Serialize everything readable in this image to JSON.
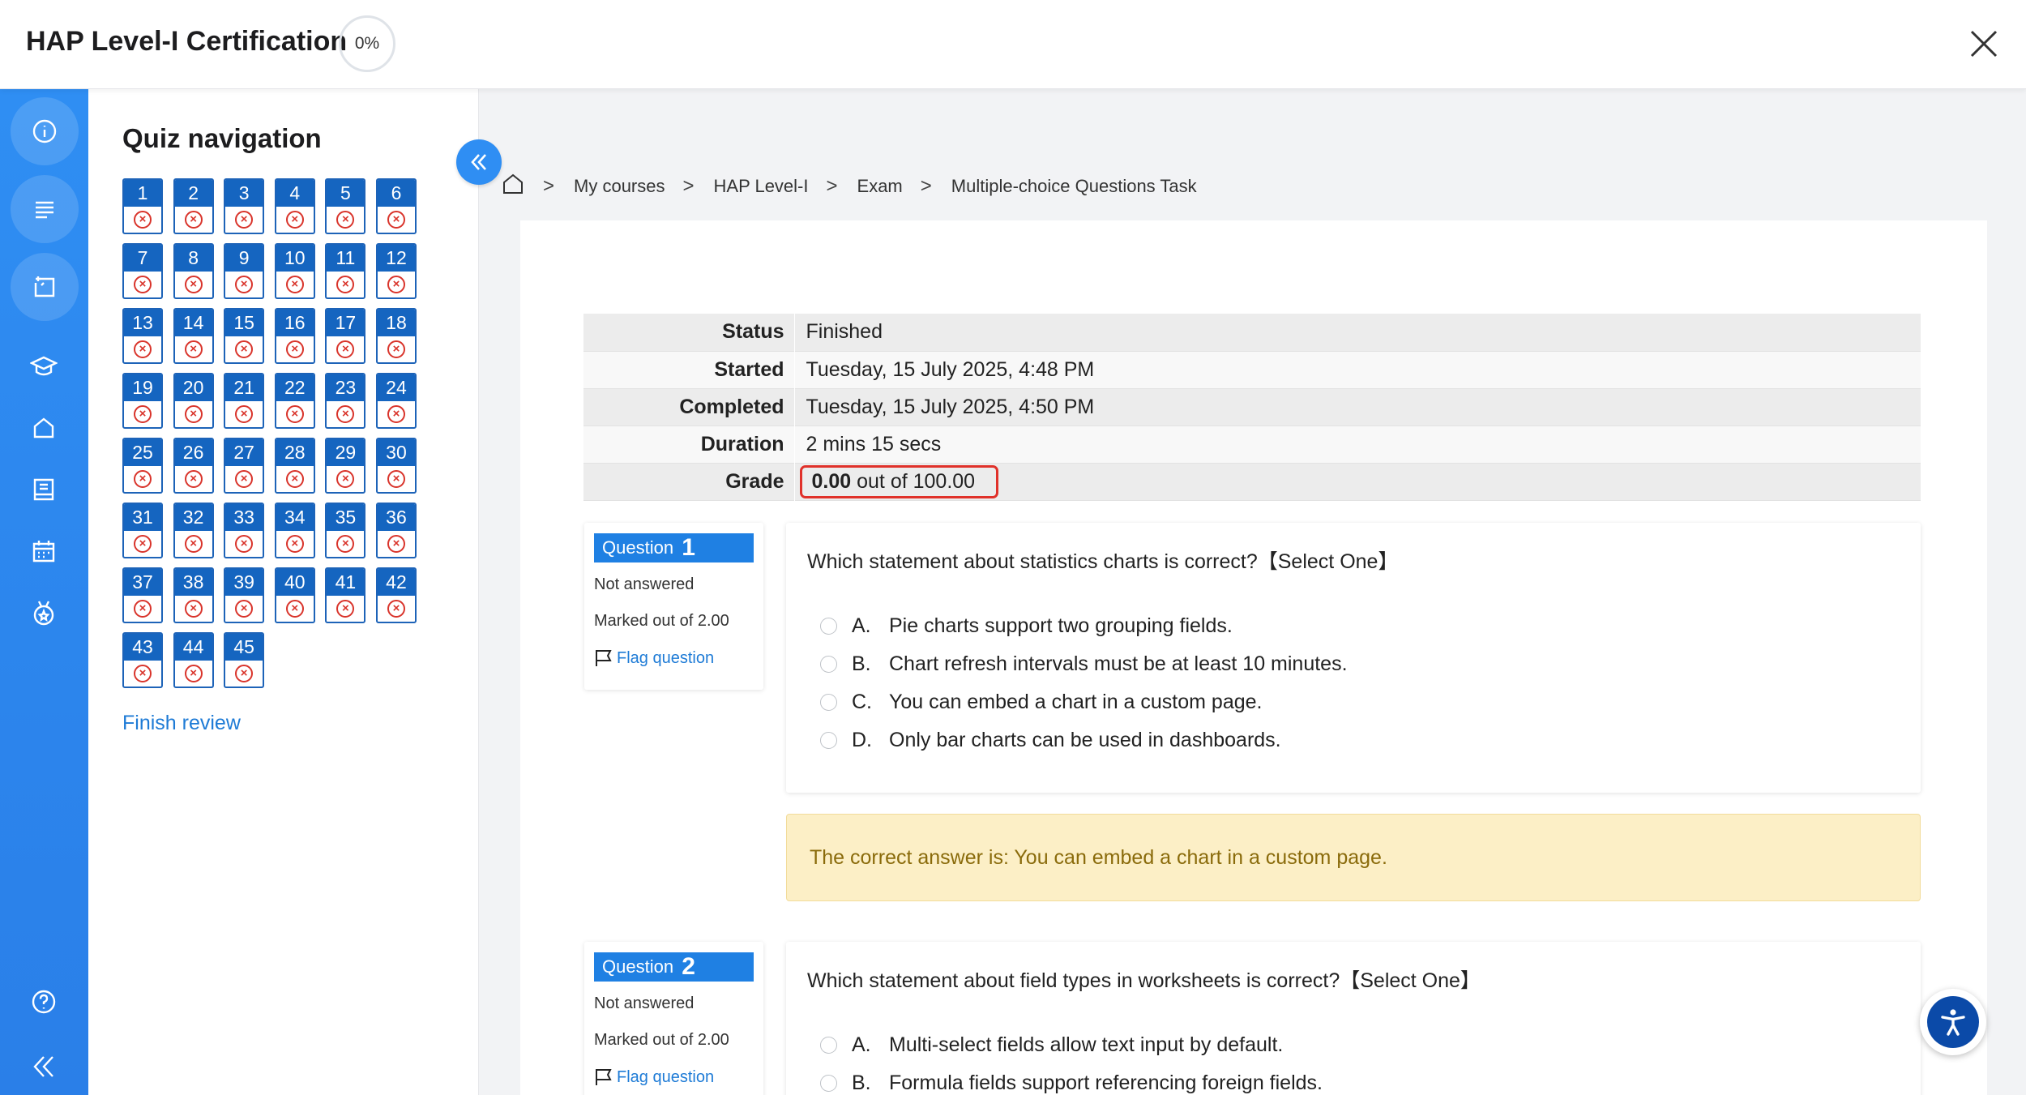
{
  "header": {
    "title": "HAP Level-I Certification",
    "progress": "0%"
  },
  "rail": {
    "icons": [
      "info-icon",
      "list-icon",
      "exam-icon",
      "graduation-cap-icon",
      "home-icon",
      "book-icon",
      "calendar-icon",
      "badge-icon",
      "help-icon",
      "collapse-icon"
    ]
  },
  "quiz_nav": {
    "title": "Quiz navigation",
    "questions": [
      "1",
      "2",
      "3",
      "4",
      "5",
      "6",
      "7",
      "8",
      "9",
      "10",
      "11",
      "12",
      "13",
      "14",
      "15",
      "16",
      "17",
      "18",
      "19",
      "20",
      "21",
      "22",
      "23",
      "24",
      "25",
      "26",
      "27",
      "28",
      "29",
      "30",
      "31",
      "32",
      "33",
      "34",
      "35",
      "36",
      "37",
      "38",
      "39",
      "40",
      "41",
      "42",
      "43",
      "44",
      "45"
    ],
    "incorrect_mark": "×",
    "finish_label": "Finish review"
  },
  "breadcrumb": {
    "items": [
      "My courses",
      "HAP Level-I",
      "Exam",
      "Multiple-choice Questions Task"
    ]
  },
  "summary": {
    "rows": [
      {
        "label": "Status",
        "value": "Finished"
      },
      {
        "label": "Started",
        "value": "Tuesday, 15 July 2025, 4:48 PM"
      },
      {
        "label": "Completed",
        "value": "Tuesday, 15 July 2025, 4:50 PM"
      },
      {
        "label": "Duration",
        "value": "2 mins 15 secs"
      }
    ],
    "grade_label": "Grade",
    "grade_score": "0.00",
    "grade_rest": "out of 100.00"
  },
  "questions": [
    {
      "label": "Question",
      "number": "1",
      "state": "Not answered",
      "marked": "Marked out of 2.00",
      "flag": "Flag question",
      "text": "Which statement about statistics charts is correct?【Select One】",
      "options": [
        {
          "letter": "A.",
          "text": "Pie charts support two grouping fields."
        },
        {
          "letter": "B.",
          "text": "Chart refresh intervals must be at least 10 minutes."
        },
        {
          "letter": "C.",
          "text": "You can embed a chart in a custom page."
        },
        {
          "letter": "D.",
          "text": "Only bar charts can be used in dashboards."
        }
      ],
      "feedback": "The correct answer is: You can embed a chart in a custom page."
    },
    {
      "label": "Question",
      "number": "2",
      "state": "Not answered",
      "marked": "Marked out of 2.00",
      "flag": "Flag question",
      "text": "Which statement about field types in worksheets is correct?【Select One】",
      "options": [
        {
          "letter": "A.",
          "text": "Multi-select fields allow text input by default."
        },
        {
          "letter": "B.",
          "text": "Formula fields support referencing foreign fields."
        }
      ]
    }
  ],
  "colors": {
    "accent": "#2f8ef3",
    "nav_blue": "#1565c0",
    "incorrect": "#d9342b",
    "grade_highlight": "#e0312a",
    "feedback_bg": "#fcefc6"
  }
}
